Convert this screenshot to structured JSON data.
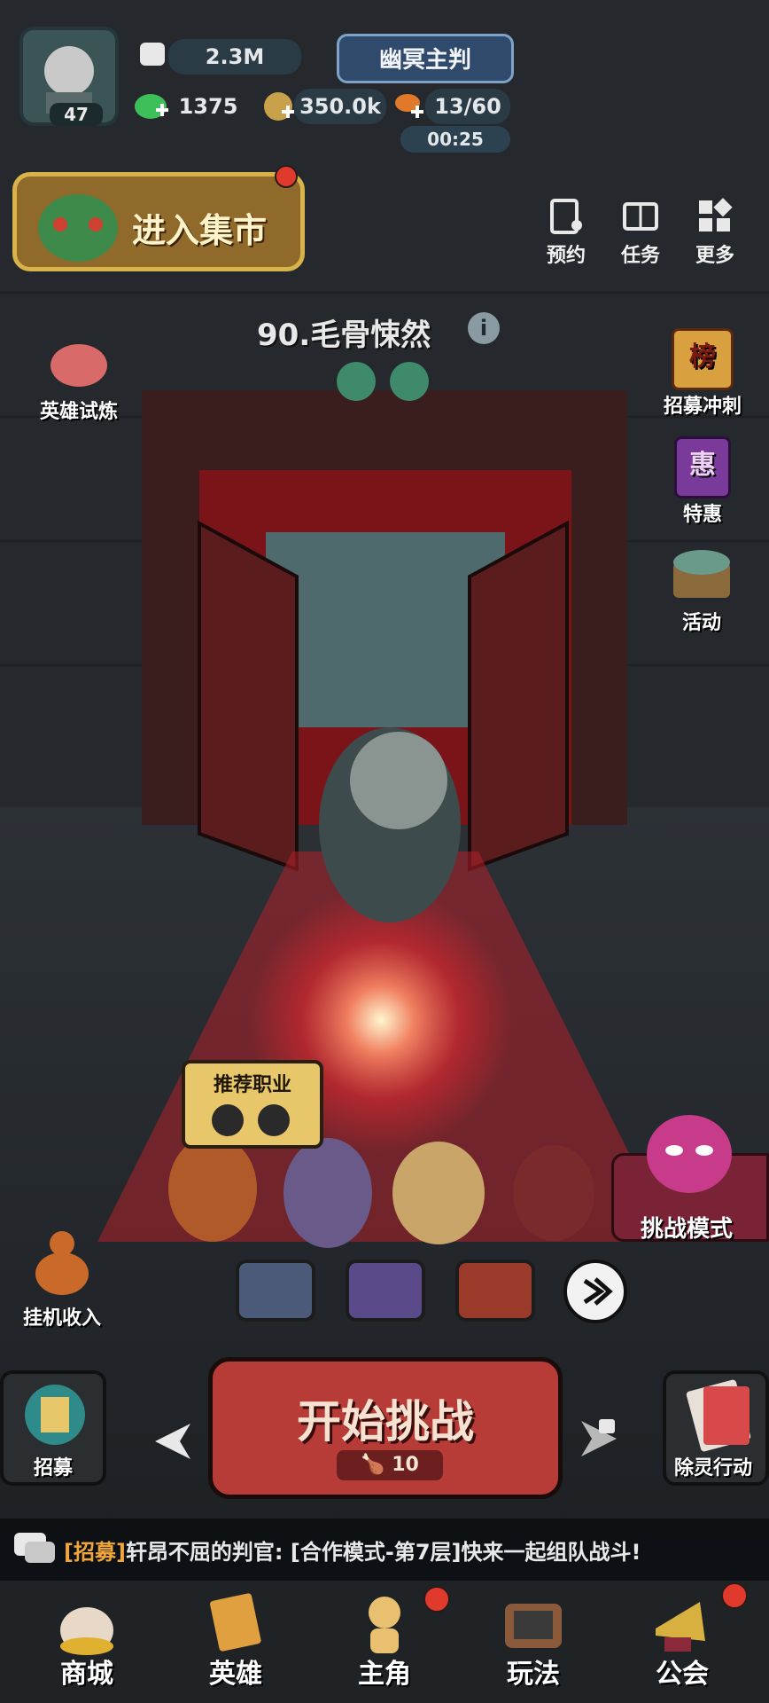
{
  "player": {
    "level": "47",
    "power": "2.3M",
    "title": "幽冥主判"
  },
  "resources": {
    "jade": "1375",
    "coins": "350.0k",
    "stamina": "13/60",
    "stamina_timer": "00:25"
  },
  "market": {
    "label": "进入集市"
  },
  "top_menu": [
    {
      "label": "预约",
      "icon": "clipboard-icon"
    },
    {
      "label": "任务",
      "icon": "book-icon"
    },
    {
      "label": "更多",
      "icon": "grid-icon"
    }
  ],
  "left_side": {
    "hero_trial": "英雄试炼",
    "idle_income": "挂机收入",
    "recruit": "招募"
  },
  "right_side": {
    "recruit_sprint": "招募冲刺",
    "recruit_sprint_badge": "榜",
    "special": "特惠",
    "special_badge": "惠",
    "activity": "活动",
    "exorcism": "除灵行动"
  },
  "stage": {
    "title": "90.毛骨悚然",
    "info": "i"
  },
  "recommended": {
    "label": "推荐职业"
  },
  "challenge_mode": {
    "label": "挑战模式"
  },
  "start_button": {
    "label": "开始挑战",
    "cost": "10"
  },
  "chat": {
    "tag": "[招募]",
    "message": "轩昂不屈的判官: [合作模式-第7层]快来一起组队战斗!"
  },
  "nav": [
    {
      "label": "商城",
      "icon": "shop-cat-icon"
    },
    {
      "label": "英雄",
      "icon": "hero-scroll-icon"
    },
    {
      "label": "主角",
      "icon": "protagonist-icon"
    },
    {
      "label": "玩法",
      "icon": "tv-icon"
    },
    {
      "label": "公会",
      "icon": "horn-icon"
    }
  ],
  "colors": {
    "accent_red": "#e03a2c",
    "start_red": "#b73b37",
    "gold": "#d8b34a",
    "bg": "#1c2024"
  }
}
